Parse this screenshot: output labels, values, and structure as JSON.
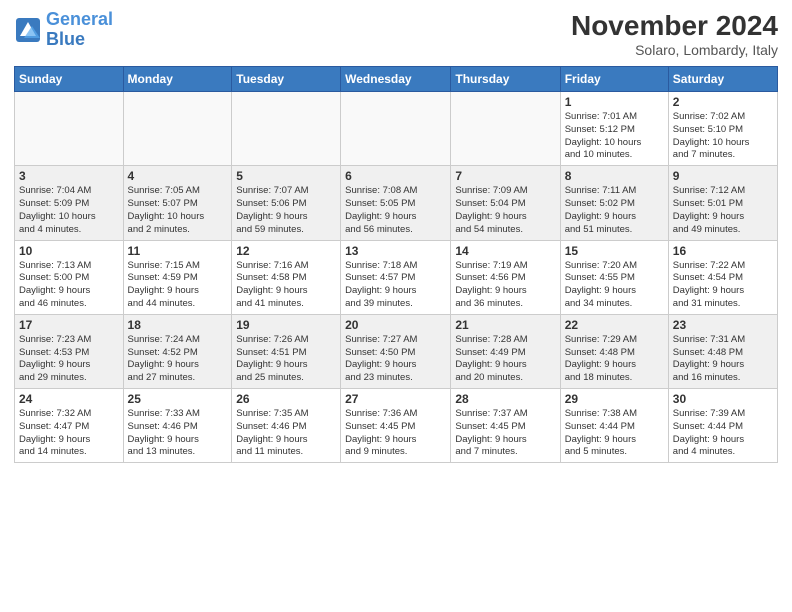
{
  "logo": {
    "text_general": "General",
    "text_blue": "Blue"
  },
  "header": {
    "month": "November 2024",
    "location": "Solaro, Lombardy, Italy"
  },
  "weekdays": [
    "Sunday",
    "Monday",
    "Tuesday",
    "Wednesday",
    "Thursday",
    "Friday",
    "Saturday"
  ],
  "weeks": [
    [
      {
        "day": "",
        "info": ""
      },
      {
        "day": "",
        "info": ""
      },
      {
        "day": "",
        "info": ""
      },
      {
        "day": "",
        "info": ""
      },
      {
        "day": "",
        "info": ""
      },
      {
        "day": "1",
        "info": "Sunrise: 7:01 AM\nSunset: 5:12 PM\nDaylight: 10 hours\nand 10 minutes."
      },
      {
        "day": "2",
        "info": "Sunrise: 7:02 AM\nSunset: 5:10 PM\nDaylight: 10 hours\nand 7 minutes."
      }
    ],
    [
      {
        "day": "3",
        "info": "Sunrise: 7:04 AM\nSunset: 5:09 PM\nDaylight: 10 hours\nand 4 minutes."
      },
      {
        "day": "4",
        "info": "Sunrise: 7:05 AM\nSunset: 5:07 PM\nDaylight: 10 hours\nand 2 minutes."
      },
      {
        "day": "5",
        "info": "Sunrise: 7:07 AM\nSunset: 5:06 PM\nDaylight: 9 hours\nand 59 minutes."
      },
      {
        "day": "6",
        "info": "Sunrise: 7:08 AM\nSunset: 5:05 PM\nDaylight: 9 hours\nand 56 minutes."
      },
      {
        "day": "7",
        "info": "Sunrise: 7:09 AM\nSunset: 5:04 PM\nDaylight: 9 hours\nand 54 minutes."
      },
      {
        "day": "8",
        "info": "Sunrise: 7:11 AM\nSunset: 5:02 PM\nDaylight: 9 hours\nand 51 minutes."
      },
      {
        "day": "9",
        "info": "Sunrise: 7:12 AM\nSunset: 5:01 PM\nDaylight: 9 hours\nand 49 minutes."
      }
    ],
    [
      {
        "day": "10",
        "info": "Sunrise: 7:13 AM\nSunset: 5:00 PM\nDaylight: 9 hours\nand 46 minutes."
      },
      {
        "day": "11",
        "info": "Sunrise: 7:15 AM\nSunset: 4:59 PM\nDaylight: 9 hours\nand 44 minutes."
      },
      {
        "day": "12",
        "info": "Sunrise: 7:16 AM\nSunset: 4:58 PM\nDaylight: 9 hours\nand 41 minutes."
      },
      {
        "day": "13",
        "info": "Sunrise: 7:18 AM\nSunset: 4:57 PM\nDaylight: 9 hours\nand 39 minutes."
      },
      {
        "day": "14",
        "info": "Sunrise: 7:19 AM\nSunset: 4:56 PM\nDaylight: 9 hours\nand 36 minutes."
      },
      {
        "day": "15",
        "info": "Sunrise: 7:20 AM\nSunset: 4:55 PM\nDaylight: 9 hours\nand 34 minutes."
      },
      {
        "day": "16",
        "info": "Sunrise: 7:22 AM\nSunset: 4:54 PM\nDaylight: 9 hours\nand 31 minutes."
      }
    ],
    [
      {
        "day": "17",
        "info": "Sunrise: 7:23 AM\nSunset: 4:53 PM\nDaylight: 9 hours\nand 29 minutes."
      },
      {
        "day": "18",
        "info": "Sunrise: 7:24 AM\nSunset: 4:52 PM\nDaylight: 9 hours\nand 27 minutes."
      },
      {
        "day": "19",
        "info": "Sunrise: 7:26 AM\nSunset: 4:51 PM\nDaylight: 9 hours\nand 25 minutes."
      },
      {
        "day": "20",
        "info": "Sunrise: 7:27 AM\nSunset: 4:50 PM\nDaylight: 9 hours\nand 23 minutes."
      },
      {
        "day": "21",
        "info": "Sunrise: 7:28 AM\nSunset: 4:49 PM\nDaylight: 9 hours\nand 20 minutes."
      },
      {
        "day": "22",
        "info": "Sunrise: 7:29 AM\nSunset: 4:48 PM\nDaylight: 9 hours\nand 18 minutes."
      },
      {
        "day": "23",
        "info": "Sunrise: 7:31 AM\nSunset: 4:48 PM\nDaylight: 9 hours\nand 16 minutes."
      }
    ],
    [
      {
        "day": "24",
        "info": "Sunrise: 7:32 AM\nSunset: 4:47 PM\nDaylight: 9 hours\nand 14 minutes."
      },
      {
        "day": "25",
        "info": "Sunrise: 7:33 AM\nSunset: 4:46 PM\nDaylight: 9 hours\nand 13 minutes."
      },
      {
        "day": "26",
        "info": "Sunrise: 7:35 AM\nSunset: 4:46 PM\nDaylight: 9 hours\nand 11 minutes."
      },
      {
        "day": "27",
        "info": "Sunrise: 7:36 AM\nSunset: 4:45 PM\nDaylight: 9 hours\nand 9 minutes."
      },
      {
        "day": "28",
        "info": "Sunrise: 7:37 AM\nSunset: 4:45 PM\nDaylight: 9 hours\nand 7 minutes."
      },
      {
        "day": "29",
        "info": "Sunrise: 7:38 AM\nSunset: 4:44 PM\nDaylight: 9 hours\nand 5 minutes."
      },
      {
        "day": "30",
        "info": "Sunrise: 7:39 AM\nSunset: 4:44 PM\nDaylight: 9 hours\nand 4 minutes."
      }
    ]
  ]
}
